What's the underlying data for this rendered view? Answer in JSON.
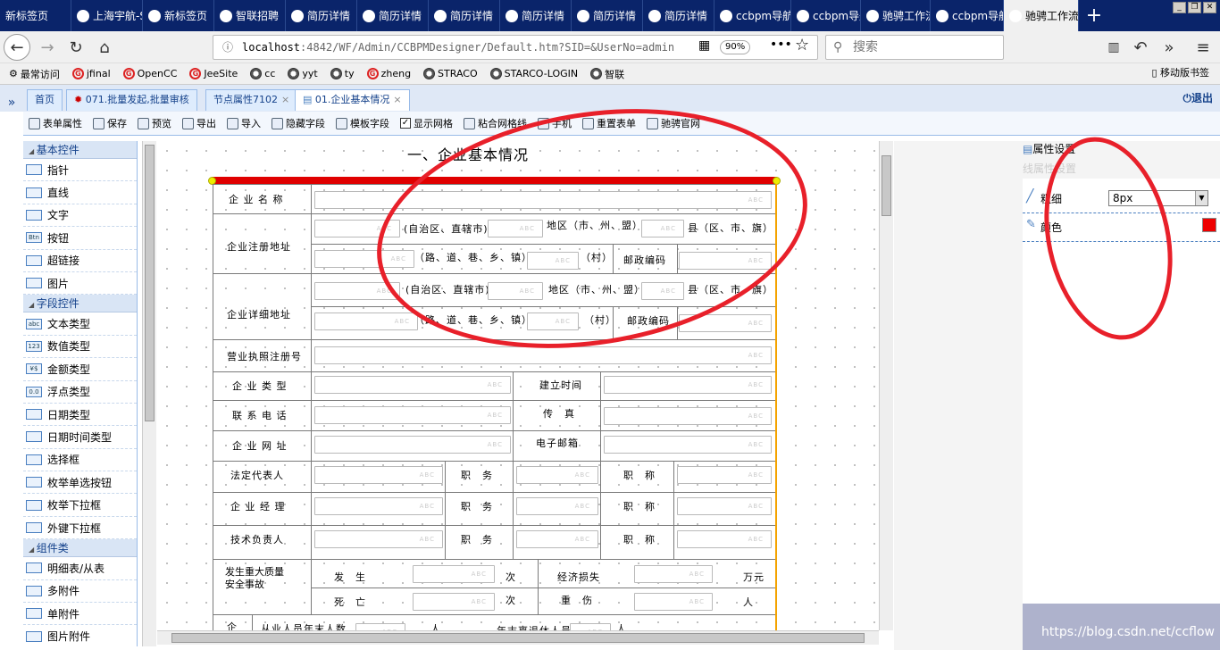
{
  "browser": {
    "tabs": [
      "新标签页",
      "上海宇航-S",
      "新标签页",
      "智联招聘",
      "简历详情",
      "简历详情",
      "简历详情",
      "简历详情",
      "简历详情",
      "简历详情",
      "ccbpm导航页",
      "ccbpm导航页",
      "驰骋工作流",
      "ccbpm导航页",
      "驰骋工作流"
    ],
    "url_host": "localhost",
    "url_rest": ":4842/WF/Admin/CCBPMDesigner/Default.htm?SID=&UserNo=admin",
    "zoom": "90%",
    "search_placeholder": "搜索",
    "bookmarks": [
      "最常访问",
      "jfinal",
      "OpenCC",
      "JeeSite",
      "cc",
      "yyt",
      "ty",
      "zheng",
      "STRACO",
      "STARCO-LOGIN",
      "智联"
    ],
    "mobile_bookmarks": "移动版书签"
  },
  "app": {
    "tabs": [
      {
        "label": "首页"
      },
      {
        "label": "071.批量发起,批量审核"
      },
      {
        "label": "节点属性7102"
      },
      {
        "label": "01.企业基本情况"
      }
    ],
    "logout": "退出",
    "toolbar": [
      "表单属性",
      "保存",
      "预览",
      "导出",
      "导入",
      "隐藏字段",
      "模板字段",
      "显示网格",
      "粘合网格线",
      "手机",
      "重置表单",
      "驰骋官网"
    ]
  },
  "left_panel": {
    "groups": [
      {
        "title": "基本控件",
        "items": [
          {
            "label": "指针",
            "icon": "pointer-icon"
          },
          {
            "label": "直线",
            "icon": "line-icon"
          },
          {
            "label": "文字",
            "icon": "text-icon"
          },
          {
            "label": "按钮",
            "icon": "button-icon",
            "icon_text": "Btn"
          },
          {
            "label": "超链接",
            "icon": "link-icon"
          },
          {
            "label": "图片",
            "icon": "image-icon"
          }
        ]
      },
      {
        "title": "字段控件",
        "items": [
          {
            "label": "文本类型",
            "icon": "text-type-icon",
            "icon_text": "abc"
          },
          {
            "label": "数值类型",
            "icon": "number-type-icon",
            "icon_text": "123"
          },
          {
            "label": "金额类型",
            "icon": "money-type-icon",
            "icon_text": "¥$"
          },
          {
            "label": "浮点类型",
            "icon": "float-type-icon",
            "icon_text": "0.0"
          },
          {
            "label": "日期类型",
            "icon": "date-type-icon"
          },
          {
            "label": "日期时间类型",
            "icon": "datetime-type-icon"
          },
          {
            "label": "选择框",
            "icon": "checkbox-icon"
          },
          {
            "label": "枚举单选按钮",
            "icon": "radio-icon"
          },
          {
            "label": "枚举下拉框",
            "icon": "enum-dropdown-icon"
          },
          {
            "label": "外键下拉框",
            "icon": "fk-dropdown-icon"
          }
        ]
      },
      {
        "title": "组件类",
        "items": [
          {
            "label": "明细表/从表",
            "icon": "detail-table-icon"
          },
          {
            "label": "多附件",
            "icon": "multi-attach-icon"
          },
          {
            "label": "单附件",
            "icon": "single-attach-icon"
          },
          {
            "label": "图片附件",
            "icon": "image-attach-icon"
          }
        ]
      }
    ]
  },
  "form": {
    "title": "一、企业基本情况",
    "labels": {
      "company_name": "企 业 名 称",
      "reg_address": "企业注册地址",
      "detail_address": "企业详细地址",
      "license_no": "营业执照注册号",
      "company_type": "企 业 类 型",
      "found_time": "建立时间",
      "phone": "联 系 电 话",
      "fax": "传　真",
      "website": "企 业 网 址",
      "email": "电子邮箱",
      "legal_rep": "法定代表人",
      "manager": "企 业 经 理",
      "tech_lead": "技术负责人",
      "duty": "职　务",
      "title": "职　称",
      "accident": "发生重大质量安全事故",
      "occurred": "发　生",
      "times": "次",
      "econ_loss": "经济损失",
      "wan_yuan": "万元",
      "death": "死　亡",
      "injury": "重　伤",
      "person": "人",
      "bottom_left": "企",
      "employees": "从业人员年末人数",
      "retired": "年末离退休人员",
      "zone": "(自治区、直辖市)",
      "city": "地区（市、州、盟）",
      "county": "县（区、市、旗）",
      "road": "（路、道、巷、乡、镇）",
      "village": "（村）",
      "postcode": "邮政编码"
    },
    "placeholder": "ABC"
  },
  "properties": {
    "title": "属性设置",
    "subtitle": "线属性设置",
    "thickness_label": "粗细",
    "thickness_value": "8px",
    "color_label": "颜色",
    "color_value": "#ee0000"
  },
  "watermark": "https://blog.csdn.net/ccflow"
}
